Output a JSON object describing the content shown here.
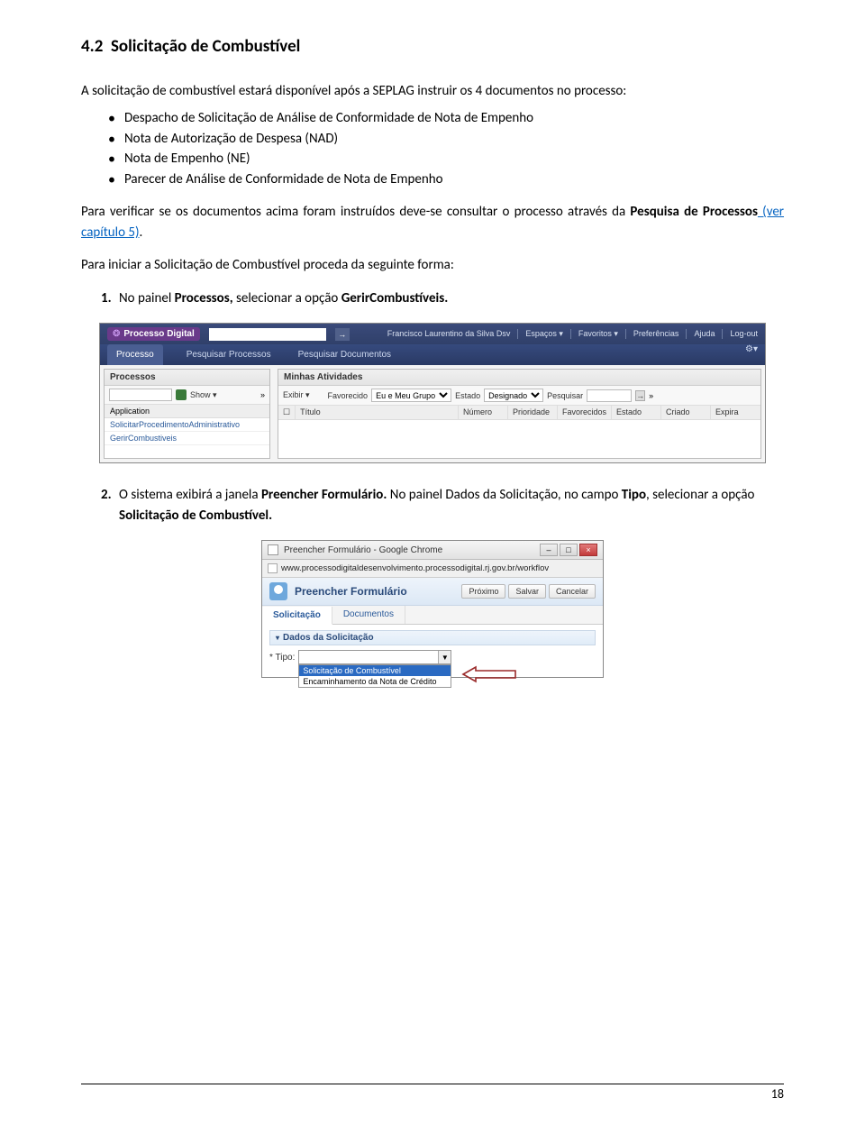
{
  "section": {
    "number": "4.2",
    "title": "Solicitação de Combustível"
  },
  "intro": "A solicitação de combustível estará disponível após a SEPLAG instruir os 4 documentos no processo:",
  "bullets": [
    "Despacho de Solicitação de Análise de Conformidade de Nota de Empenho",
    "Nota de Autorização de Despesa (NAD)",
    "Nota de Empenho (NE)",
    "Parecer de Análise de Conformidade de Nota de Empenho"
  ],
  "para2_a": "Para verificar se os documentos acima foram instruídos deve-se consultar o processo através da ",
  "para2_bold": "Pesquisa de Processos",
  "para2_link": " (ver capítulo 5)",
  "para2_end": ".",
  "para3": "Para iniciar a Solicitação de Combustível proceda da seguinte forma:",
  "step1_num": "1.",
  "step1_a": "No painel ",
  "step1_b": "Processos,",
  "step1_c": " selecionar a opção ",
  "step1_d": "GerirCombustíveis.",
  "step2_num": "2.",
  "step2_a": "O sistema exibirá a janela ",
  "step2_b": "Preencher Formulário.",
  "step2_c": " No painel Dados da Solicitação, no campo ",
  "step2_d": "Tipo",
  "step2_e": ", selecionar a opção ",
  "step2_f": "Solicitação de Combustível.",
  "shot1": {
    "brand": "Processo Digital",
    "user": "Francisco Laurentino da Silva Dsv",
    "toplinks": [
      "Espaços ▾",
      "Favoritos ▾",
      "Preferências",
      "Ajuda",
      "Log-out"
    ],
    "tabs": [
      "Processo",
      "Pesquisar Processos",
      "Pesquisar Documentos"
    ],
    "left_title": "Processos",
    "left_show": "Show ▾",
    "left_head": "Application",
    "left_rows": [
      "SolicitarProcedimentoAdministrativo",
      "GerirCombustiveis"
    ],
    "right_title": "Minhas Atividades",
    "rt_exibir": "Exibir ▾",
    "rt_fav": "Favorecido",
    "rt_fav_val": "Eu e Meu Grupo",
    "rt_estado": "Estado",
    "rt_estado_val": "Designado",
    "rt_pesq": "Pesquisar",
    "cols": [
      "",
      "Título",
      "Número",
      "Prioridade",
      "Favorecidos",
      "Estado",
      "Criado",
      "Expira"
    ]
  },
  "shot2": {
    "wintitle": "Preencher Formulário - Google Chrome",
    "url": "www.processodigitaldesenvolvimento.processodigital.rj.gov.br/workflov",
    "form_title": "Preencher Formulário",
    "btns": [
      "Próximo",
      "Salvar",
      "Cancelar"
    ],
    "tabs": [
      "Solicitação",
      "Documentos"
    ],
    "sec": "Dados da Solicitação",
    "label": "* Tipo:",
    "opts": [
      "Solicitação de Combustível",
      "Encaminhamento da Nota de Crédito"
    ]
  },
  "pagenum": "18"
}
